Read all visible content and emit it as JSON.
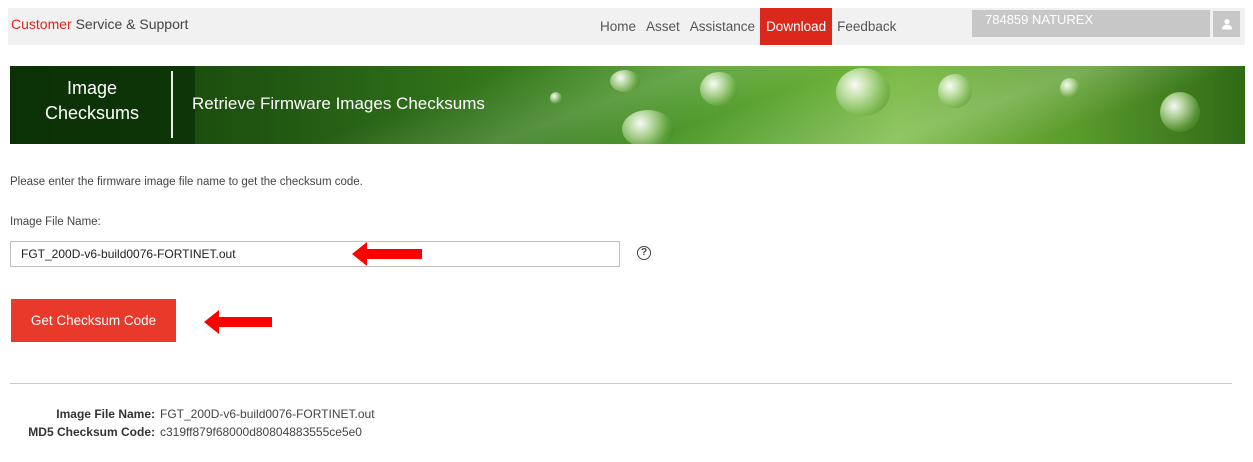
{
  "header": {
    "brand_part1": "Customer",
    "brand_part2": "Service & Support",
    "nav": [
      "Home",
      "Asset",
      "Assistance",
      "Download",
      "Feedback"
    ],
    "active_nav": "Download",
    "account_label": "784859 NATUREX",
    "user_icon": "user-icon"
  },
  "banner": {
    "title_line1": "Image",
    "title_line2": "Checksums",
    "subtitle": "Retrieve Firmware Images Checksums"
  },
  "form": {
    "intro": "Please enter the firmware image file name to get the checksum code.",
    "label": "Image File Name:",
    "value": "FGT_200D-v6-build0076-FORTINET.out",
    "help_glyph": "?",
    "submit_label": "Get Checksum Code"
  },
  "result": {
    "file_key": "Image File Name:",
    "file_value": "FGT_200D-v6-build0076-FORTINET.out",
    "md5_key": "MD5 Checksum Code:",
    "md5_value": "c319ff879f68000d80804883555ce5e0"
  },
  "colors": {
    "accent": "#da291c",
    "button": "#e8392b",
    "annotation_arrow": "#ff0000"
  }
}
